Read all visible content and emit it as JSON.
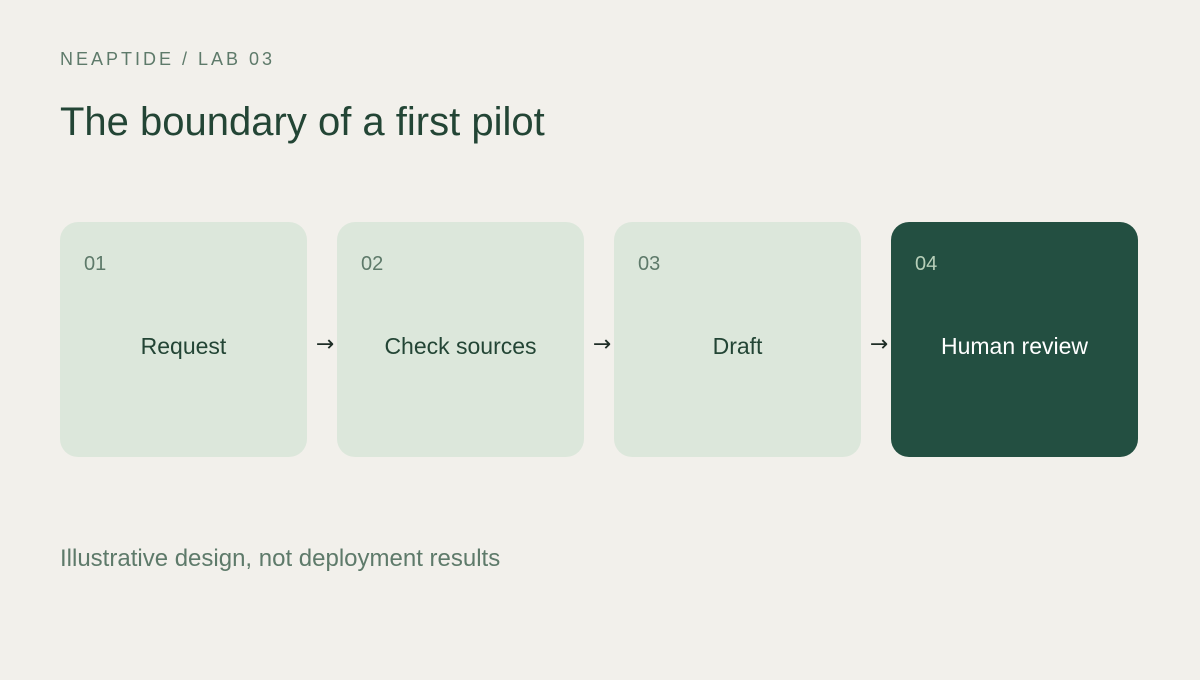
{
  "header": {
    "eyebrow": "NEAPTIDE / LAB 03",
    "title": "The boundary of a first pilot"
  },
  "flow": {
    "steps": [
      {
        "number": "01",
        "label": "Request",
        "highlighted": false
      },
      {
        "number": "02",
        "label": "Check sources",
        "highlighted": false
      },
      {
        "number": "03",
        "label": "Draft",
        "highlighted": false
      },
      {
        "number": "04",
        "label": "Human review",
        "highlighted": true
      }
    ],
    "connector": "→"
  },
  "footnote": "Illustrative design, not deployment results",
  "colors": {
    "background": "#f2f0eb",
    "card": "#dce7db",
    "card_highlight": "#234f41",
    "text_dark": "#234535",
    "text_muted": "#5e7a6a"
  }
}
